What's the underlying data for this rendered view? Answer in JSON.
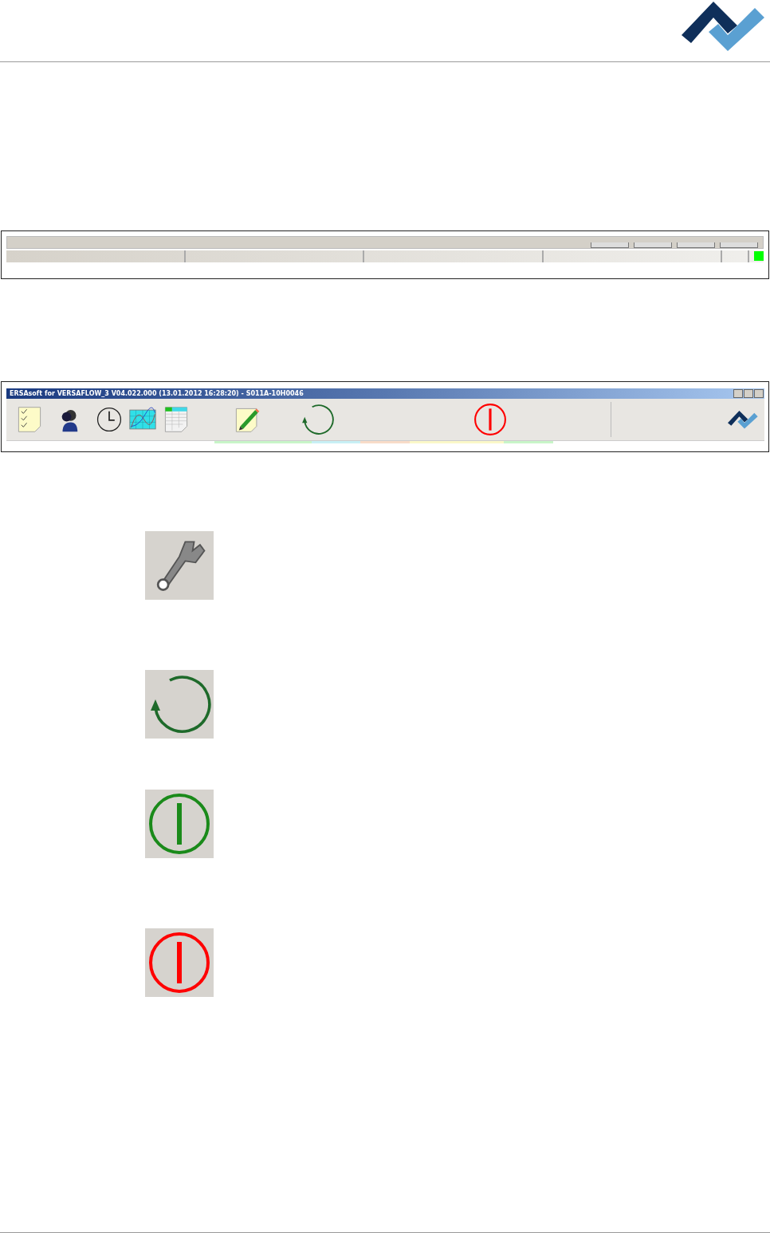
{
  "status_bar": {
    "indicator_on": true
  },
  "window": {
    "title": "ERSAsoft for VERSAFLOW_3 V04.022.000 (13.01.2012 16:28:20) - S011A-10H0046"
  },
  "toolbar": [
    {
      "kind": "checklist"
    },
    {
      "kind": "users"
    },
    {
      "kind": "clock"
    },
    {
      "kind": "chart"
    },
    {
      "kind": "table"
    },
    {
      "kind": "edit"
    },
    {
      "kind": "refresh"
    },
    {
      "kind": "power",
      "color": "#ff0000"
    }
  ],
  "color_strip": [
    {
      "color": "#c8f5c8"
    },
    {
      "color": "#c8f0f5"
    },
    {
      "color": "#f8dcc8"
    },
    {
      "color": "#fbf8c8"
    },
    {
      "color": "#c8f5c8"
    }
  ],
  "icons": [
    {
      "kind": "wrench"
    },
    {
      "kind": "refresh"
    },
    {
      "kind": "power",
      "color": "#1a8a1a"
    },
    {
      "kind": "power",
      "color": "#ff0000"
    }
  ]
}
